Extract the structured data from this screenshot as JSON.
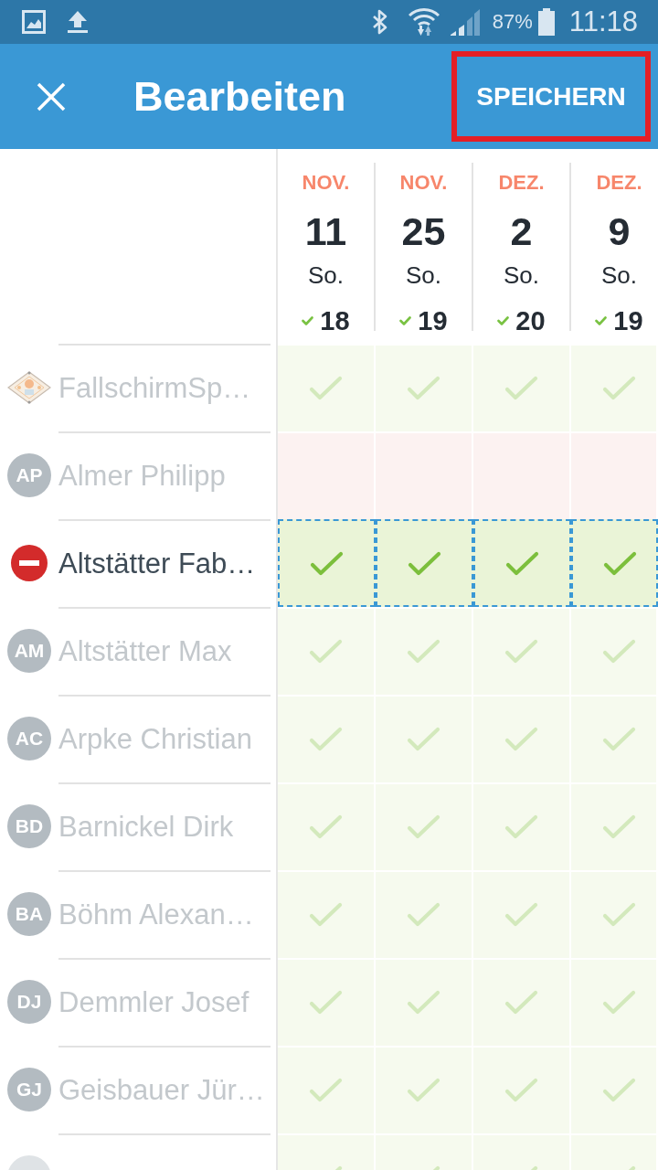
{
  "status_bar": {
    "battery_text": "87%",
    "time": "11:18"
  },
  "toolbar": {
    "title": "Bearbeiten",
    "save_button": {
      "label": "SPEICHERN",
      "highlighted": true
    }
  },
  "dates": [
    {
      "month": "NOV.",
      "day": "11",
      "weekday": "So.",
      "count": "18"
    },
    {
      "month": "NOV.",
      "day": "25",
      "weekday": "So.",
      "count": "19"
    },
    {
      "month": "DEZ.",
      "day": "2",
      "weekday": "So.",
      "count": "20"
    },
    {
      "month": "DEZ.",
      "day": "9",
      "weekday": "So.",
      "count": "19"
    }
  ],
  "rows": [
    {
      "avatar": {
        "kind": "emblem"
      },
      "name": "FallschirmSp…",
      "selected": false,
      "cells": [
        {
          "checked": true
        },
        {
          "checked": true
        },
        {
          "checked": true
        },
        {
          "checked": true
        }
      ]
    },
    {
      "avatar": {
        "kind": "initials",
        "initials": "AP"
      },
      "name": "Almer Philipp",
      "selected": false,
      "cells": [
        {
          "checked": false
        },
        {
          "checked": false
        },
        {
          "checked": false
        },
        {
          "checked": false
        }
      ]
    },
    {
      "avatar": {
        "kind": "remove"
      },
      "name": "Altstätter Fab…",
      "selected": true,
      "cells": [
        {
          "checked": true
        },
        {
          "checked": true
        },
        {
          "checked": true
        },
        {
          "checked": true
        }
      ]
    },
    {
      "avatar": {
        "kind": "initials",
        "initials": "AM"
      },
      "name": "Altstätter Max",
      "selected": false,
      "cells": [
        {
          "checked": true
        },
        {
          "checked": true
        },
        {
          "checked": true
        },
        {
          "checked": true
        }
      ]
    },
    {
      "avatar": {
        "kind": "initials",
        "initials": "AC"
      },
      "name": "Arpke Christian",
      "selected": false,
      "cells": [
        {
          "checked": true
        },
        {
          "checked": true
        },
        {
          "checked": true
        },
        {
          "checked": true
        }
      ]
    },
    {
      "avatar": {
        "kind": "initials",
        "initials": "BD"
      },
      "name": "Barnickel Dirk",
      "selected": false,
      "cells": [
        {
          "checked": true
        },
        {
          "checked": true
        },
        {
          "checked": true
        },
        {
          "checked": true
        }
      ]
    },
    {
      "avatar": {
        "kind": "initials",
        "initials": "BA"
      },
      "name": "Böhm Alexan…",
      "selected": false,
      "cells": [
        {
          "checked": true
        },
        {
          "checked": true
        },
        {
          "checked": true
        },
        {
          "checked": true
        }
      ]
    },
    {
      "avatar": {
        "kind": "initials",
        "initials": "DJ"
      },
      "name": "Demmler Josef",
      "selected": false,
      "cells": [
        {
          "checked": true
        },
        {
          "checked": true
        },
        {
          "checked": true
        },
        {
          "checked": true
        }
      ]
    },
    {
      "avatar": {
        "kind": "initials",
        "initials": "GJ"
      },
      "name": "Geisbauer Jür…",
      "selected": false,
      "cells": [
        {
          "checked": true
        },
        {
          "checked": true
        },
        {
          "checked": true
        },
        {
          "checked": true
        }
      ]
    },
    {
      "avatar": {
        "kind": "initials"
      },
      "selected": false,
      "cells": [
        {
          "checked": true
        },
        {
          "checked": true
        },
        {
          "checked": true
        },
        {
          "checked": true
        }
      ]
    }
  ]
}
